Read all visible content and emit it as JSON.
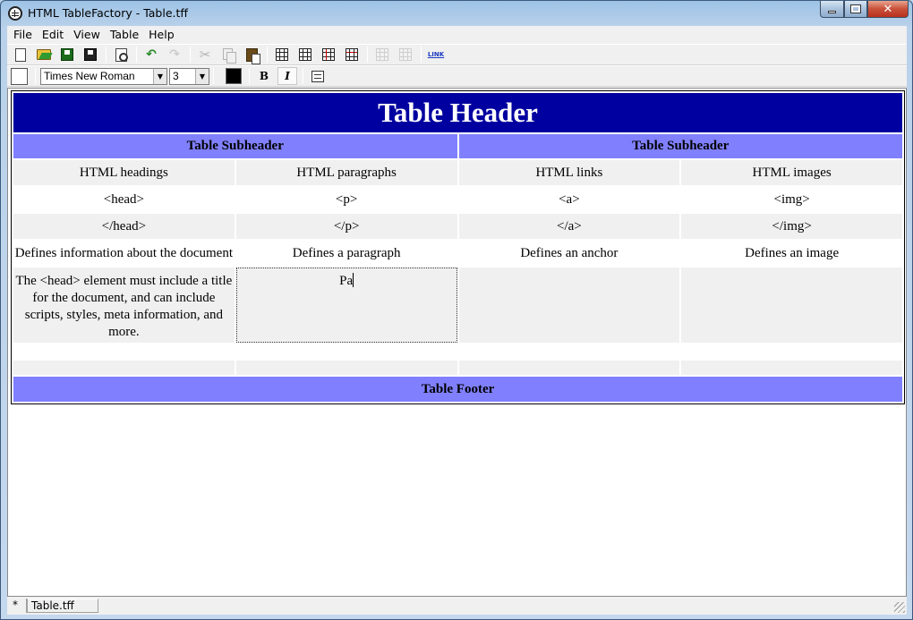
{
  "window": {
    "title": "HTML TableFactory - Table.tff",
    "min_label": "–",
    "close_label": "✕"
  },
  "menu": [
    "File",
    "Edit",
    "View",
    "Table",
    "Help"
  ],
  "toolbar": {
    "icons": [
      "new-icon",
      "open-icon",
      "save-icon",
      "save-as-icon",
      "preview-icon",
      "undo-icon",
      "redo-icon",
      "cut-icon",
      "copy-icon",
      "paste-icon",
      "insert-table-icon",
      "table-properties-icon",
      "insert-column-icon",
      "insert-row-icon",
      "delete-column-icon",
      "delete-row-icon",
      "link-icon"
    ],
    "link_label": "LINK",
    "undo_glyph": "↶",
    "redo_glyph": "↷",
    "cut_glyph": "✂"
  },
  "format_bar": {
    "font": "Times New Roman",
    "size": "3",
    "bold_label": "B",
    "italic_label": "I",
    "dropdown_glyph": "▼",
    "text_color": "#000000"
  },
  "table": {
    "header": "Table Header",
    "subheaders": [
      "Table Subheader",
      "Table Subheader"
    ],
    "rows": [
      [
        "HTML headings",
        "HTML paragraphs",
        "HTML links",
        "HTML images"
      ],
      [
        "<head>",
        "<p>",
        "<a>",
        "<img>"
      ],
      [
        "</head>",
        "</p>",
        "</a>",
        "</img>"
      ],
      [
        "Defines information about the document",
        "Defines a paragraph",
        "Defines an anchor",
        "Defines an image"
      ],
      [
        "The <head> element must include a title for the document, and can include scripts, styles, meta information, and more.",
        "Pa",
        "",
        ""
      ]
    ],
    "footer": "Table Footer",
    "colors": {
      "header_bg": "#0000a0",
      "subheader_bg": "#8080ff",
      "row_gray": "#f0f0f0"
    }
  },
  "status": {
    "modified": "*",
    "filename": "Table.tff"
  }
}
